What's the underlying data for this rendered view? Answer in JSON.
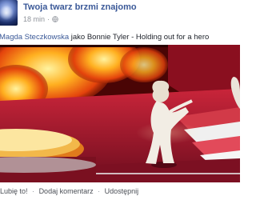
{
  "post": {
    "page_name": "Twoja twarz brzmi znajomo",
    "timestamp": "18 min",
    "privacy_icon": "globe-icon",
    "caption_name": "Magda Steczkowska",
    "caption_rest": " jako Bonnie Tyler - Holding out for a hero"
  },
  "actions": {
    "like": "Lubię to!",
    "comment": "Dodaj komentarz",
    "share": "Udostępnij",
    "separator": "·"
  },
  "colors": {
    "link": "#3b5998",
    "meta": "#90949c",
    "text": "#1d2129"
  }
}
